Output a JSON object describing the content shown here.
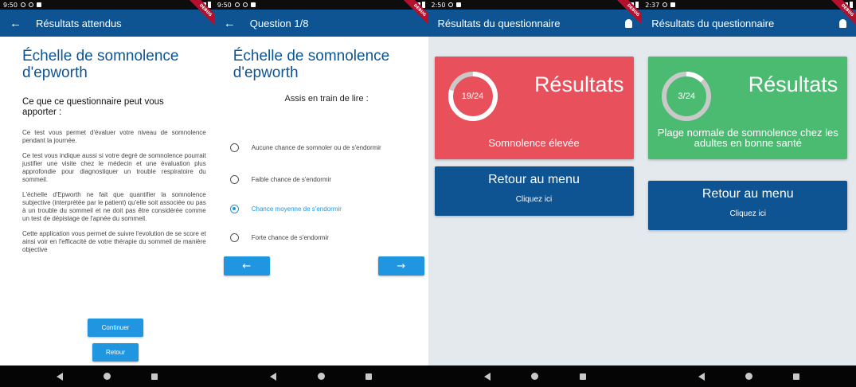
{
  "screens": [
    {
      "status": {
        "time": "9:50"
      },
      "appbar": {
        "title": "Résultats attendus"
      },
      "title": "Échelle de somnolence d'epworth",
      "subtitle": "Ce que ce questionnaire peut vous apporter :",
      "paragraphs": [
        "Ce test vous permet d'évaluer votre niveau de somnolence pendant la journée.",
        "Ce test vous indique aussi si votre degré de somnolence pourrait justifier une visite chez le médecin et une évaluation plus approfondie pour diagnostiquer un trouble respiratoire du sommeil.",
        "L'échelle d'Epworth ne fait que quantifier la somnolence subjective (interprétée par le patient) qu'elle soit associée ou pas à un trouble du sommeil et ne doit pas être considérée comme un test de dépistage de l'apnée du sommeil.",
        "Cette application vous permet de suivre l'evolution de se score et ainsi voir en l'efficacité de votre thérapie du sommeil de manière objective"
      ],
      "continue_label": "Continuer",
      "back_label": "Retour"
    },
    {
      "status": {
        "time": "9:50"
      },
      "appbar": {
        "title": "Question 1/8"
      },
      "title": "Échelle de somnolence d'epworth",
      "question": "Assis en train de lire :",
      "options": [
        "Aucune chance de somnoler ou de s'endormir",
        "Faible chance de s'endormir",
        "Chance moyenne de s'endormir",
        "Forte chance de s'endormir"
      ],
      "selected_index": 2,
      "prev_icon": "←",
      "next_icon": "→"
    },
    {
      "status": {
        "time": "2:50"
      },
      "appbar": {
        "title": "Résultats du questionnaire"
      },
      "result": {
        "title": "Résultats",
        "score": "19/24",
        "score_value": 19,
        "score_max": 24,
        "caption": "Somnolence élevée",
        "color": "#e8505b"
      },
      "menu": {
        "title": "Retour au menu",
        "subtitle": "Cliquez ici"
      }
    },
    {
      "status": {
        "time": "2:37"
      },
      "appbar": {
        "title": "Résultats du questionnaire"
      },
      "result": {
        "title": "Résultats",
        "score": "3/24",
        "score_value": 3,
        "score_max": 24,
        "caption": "Plage normale de somnolence chez les adultes en bonne santé",
        "color": "#4cbb72"
      },
      "menu": {
        "title": "Retour au menu",
        "subtitle": "Cliquez ici"
      }
    }
  ],
  "debug_banner": "DEBUG",
  "colors": {
    "primary": "#0e5493",
    "accent": "#2196e0",
    "high": "#e8505b",
    "normal": "#4cbb72"
  }
}
